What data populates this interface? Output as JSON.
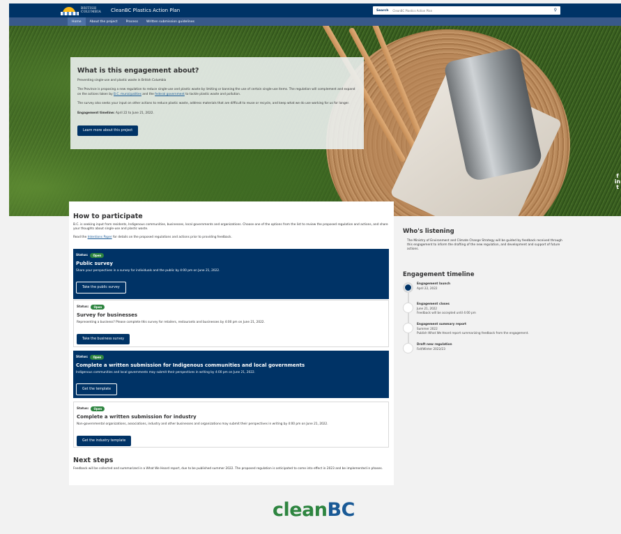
{
  "header": {
    "logo_line1": "BRITISH",
    "logo_line2": "COLUMBIA",
    "site_title": "CleanBC Plastics Action Plan",
    "search_label": "Search",
    "search_placeholder": "CleanBC Plastics Action Plan"
  },
  "nav": [
    "Home",
    "About the project",
    "Process",
    "Written submission guidelines"
  ],
  "hero": {
    "title": "What is this engagement about?",
    "intro": "Preventing single-use and plastic waste in British Columbia",
    "p2_a": "The Province is proposing a new regulation to reduce single-use and plastic waste by limiting or banning the use of certain single-use items. The regulation will complement and expand on the actions taken by ",
    "p2_link1": "B.C. municipalities",
    "p2_b": " and the ",
    "p2_link2": "federal government",
    "p2_c": " to tackle plastic waste and pollution.",
    "p3": "The survey also seeks your input on other actions to reduce plastic waste, address materials that are difficult to reuse or recycle, and keep what we do use working for us for longer.",
    "timeline_label": "Engagement timeline:",
    "timeline_value": " April 22 to June 21, 2022.",
    "button": "Learn more about this project"
  },
  "social": [
    "f",
    "in",
    "t"
  ],
  "participate": {
    "title": "How to participate",
    "p1": "B.C. is seeking input from residents, Indigenous communities, businesses, local governments and organizations. Choose one of the options from the list to review the proposed regulation and actions, and share your thoughts about single-use and plastic waste.",
    "p2_a": "Read the ",
    "p2_link": "Intentions Paper",
    "p2_b": " for details on the proposed regulations and actions prior to providing feedback.",
    "status_label": "Status:",
    "status_value": "Open",
    "cards": [
      {
        "title": "Public survey",
        "desc": "Share your perspectives in a survey for individuals and the public by 4:00 pm on June 21, 2022.",
        "button": "Take the public survey"
      },
      {
        "title": "Survey for businesses",
        "desc": "Representing a business? Please complete this survey for retailers, restaurants and businesses by 4:00 pm on June 21, 2022.",
        "button": "Take the business survey"
      },
      {
        "title": "Complete a written submission for Indigenous communities and local governments",
        "desc": "Indigenous communities and local governments may submit their perspectives in writing by 4:00 pm on June 21, 2022.",
        "button": "Get the template"
      },
      {
        "title": "Complete a written submission for industry",
        "desc": "Non-governmental organizations, associations, industry and other businesses and organizations may submit their perspectives in writing by 4:00 pm on June 21, 2022.",
        "button": "Get the industry template"
      }
    ]
  },
  "next_steps": {
    "title": "Next steps",
    "text": "Feedback will be collected and summarized in a What We Heard report, due to be published summer 2022. The proposed regulation is anticipated to come into effect in 2023 and be implemented in phases."
  },
  "listening": {
    "title": "Who's listening",
    "text": "The Ministry of Environment and Climate Change Strategy will be guided by feedback received through this engagement to inform the drafting of the new regulation, and development and support of future actions."
  },
  "timeline": {
    "title": "Engagement timeline",
    "items": [
      {
        "title": "Engagement launch",
        "lines": [
          "April 22, 2022"
        ]
      },
      {
        "title": "Engagement closes",
        "lines": [
          "June 21, 2022",
          "Feedback will be accepted until 4:00 pm"
        ]
      },
      {
        "title": "Engagement summary report",
        "lines": [
          "Summer 2022",
          "Publish What We Heard report summarizing feedback from the engagement."
        ]
      },
      {
        "title": "Draft new regulation",
        "lines": [
          "Fall/Winter 2022/23"
        ]
      }
    ]
  },
  "footer": {
    "logo_a": "clean",
    "logo_b": "BC"
  }
}
